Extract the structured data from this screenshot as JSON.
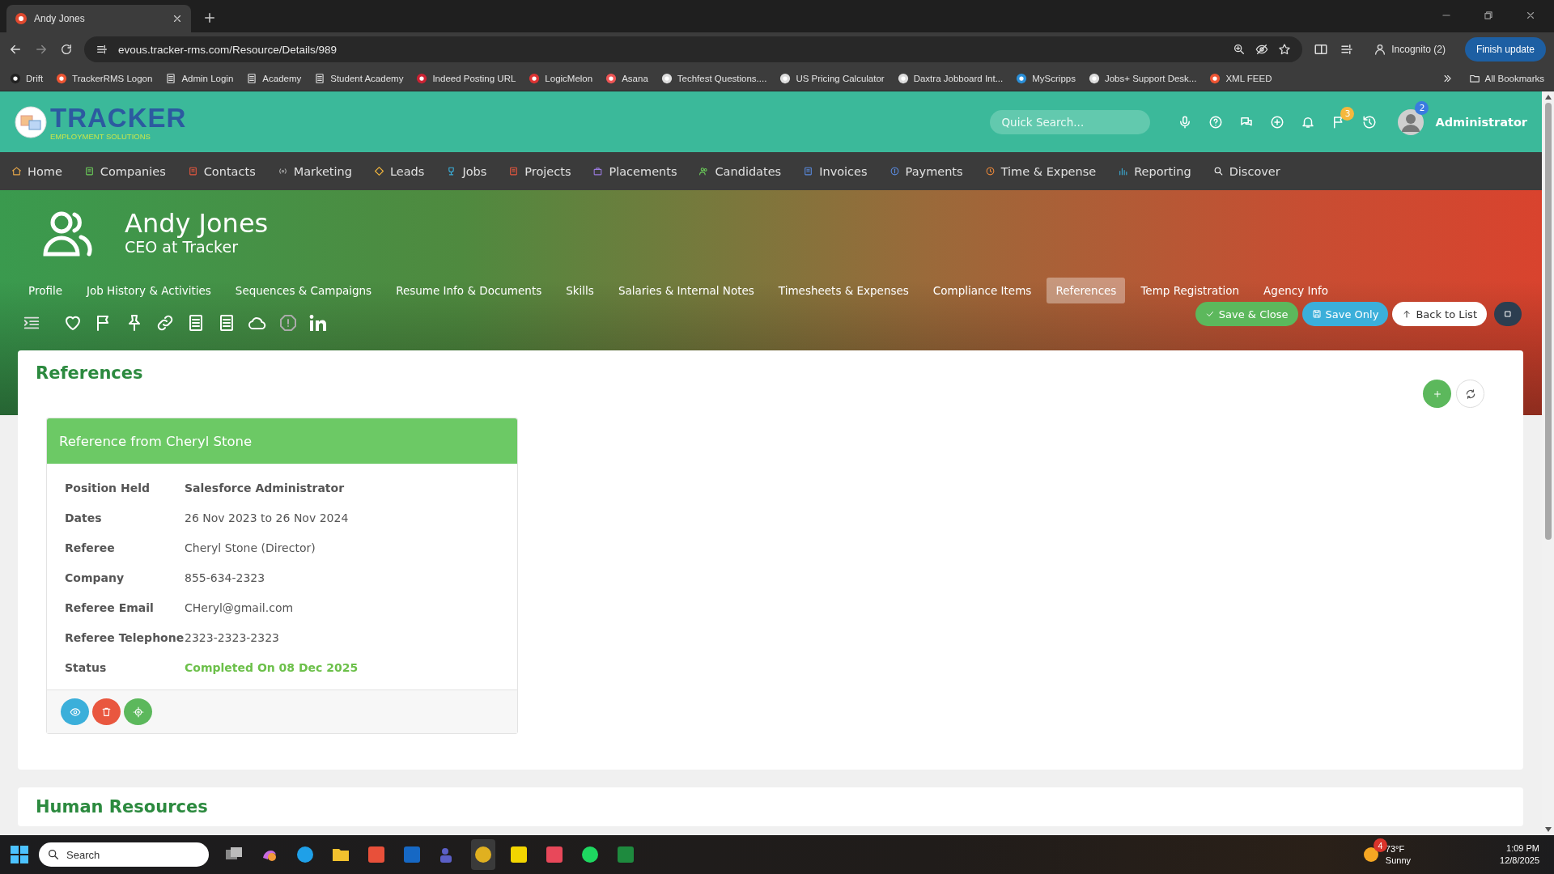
{
  "browser": {
    "tab_title": "Andy Jones",
    "url": "evous.tracker-rms.com/Resource/Details/989",
    "incognito": "Incognito (2)",
    "update_button": "Finish update",
    "bookmarks": [
      {
        "label": "Drift"
      },
      {
        "label": "TrackerRMS Logon"
      },
      {
        "label": "Admin Login"
      },
      {
        "label": "Academy"
      },
      {
        "label": "Student Academy"
      },
      {
        "label": "Indeed Posting URL"
      },
      {
        "label": "LogicMelon"
      },
      {
        "label": "Asana"
      },
      {
        "label": "Techfest Questions...."
      },
      {
        "label": "US Pricing Calculator"
      },
      {
        "label": "Daxtra Jobboard Int..."
      },
      {
        "label": "MyScripps"
      },
      {
        "label": "Jobs+ Support Desk..."
      },
      {
        "label": "XML FEED"
      }
    ],
    "all_bookmarks": "All Bookmarks"
  },
  "app_header": {
    "logo_title": "TRACKER",
    "logo_subtitle": "EMPLOYMENT SOLUTIONS",
    "search": {
      "placeholder": "Quick Search..."
    },
    "flag_badge": "3",
    "avatar_badge": "2",
    "user": "Administrator"
  },
  "nav": [
    {
      "label": "Home"
    },
    {
      "label": "Companies"
    },
    {
      "label": "Contacts"
    },
    {
      "label": "Marketing"
    },
    {
      "label": "Leads"
    },
    {
      "label": "Jobs"
    },
    {
      "label": "Projects"
    },
    {
      "label": "Placements"
    },
    {
      "label": "Candidates"
    },
    {
      "label": "Invoices"
    },
    {
      "label": "Payments"
    },
    {
      "label": "Time & Expense"
    },
    {
      "label": "Reporting"
    },
    {
      "label": "Discover"
    }
  ],
  "profile": {
    "name": "Andy Jones",
    "title": "CEO at Tracker",
    "tabs": [
      {
        "label": "Profile",
        "selected": false
      },
      {
        "label": "Job History & Activities",
        "selected": false
      },
      {
        "label": "Sequences & Campaigns",
        "selected": false
      },
      {
        "label": "Resume Info & Documents",
        "selected": false
      },
      {
        "label": "Skills",
        "selected": false
      },
      {
        "label": "Salaries & Internal Notes",
        "selected": false
      },
      {
        "label": "Timesheets & Expenses",
        "selected": false
      },
      {
        "label": "Compliance Items",
        "selected": false
      },
      {
        "label": "References",
        "selected": true
      },
      {
        "label": "Temp Registration",
        "selected": false
      },
      {
        "label": "Agency Info",
        "selected": false
      }
    ],
    "actions": [
      {
        "label": "Save & Close",
        "kind": "save-close"
      },
      {
        "label": "Save Only",
        "kind": "save"
      },
      {
        "label": "Back to List",
        "kind": "back"
      }
    ]
  },
  "references": {
    "title": "References",
    "cards": [
      {
        "title": "Reference from Cheryl Stone",
        "fields": [
          {
            "label": "Position Held",
            "value": "Salesforce Administrator",
            "kind": "bold"
          },
          {
            "label": "Dates",
            "value": "26 Nov 2023 to 26 Nov 2024",
            "kind": "text"
          },
          {
            "label": "Referee",
            "value": "Cheryl Stone (Director)",
            "kind": "text"
          },
          {
            "label": "Company",
            "value": "855-634-2323",
            "kind": "text"
          },
          {
            "label": "Referee Email",
            "value": "CHeryl@gmail.com",
            "kind": "text"
          },
          {
            "label": "Referee Telephone",
            "value": "2323-2323-2323",
            "kind": "text"
          },
          {
            "label": "Status",
            "value": "Completed On 08 Dec 2025",
            "kind": "status"
          }
        ]
      }
    ]
  },
  "next_section": {
    "title": "Human Resources"
  },
  "taskbar": {
    "search": {
      "placeholder": "Search"
    },
    "weather_badge": "4",
    "temperature": "73°F",
    "condition": "Sunny",
    "time": "1:09 PM",
    "date": "12/8/2025"
  }
}
